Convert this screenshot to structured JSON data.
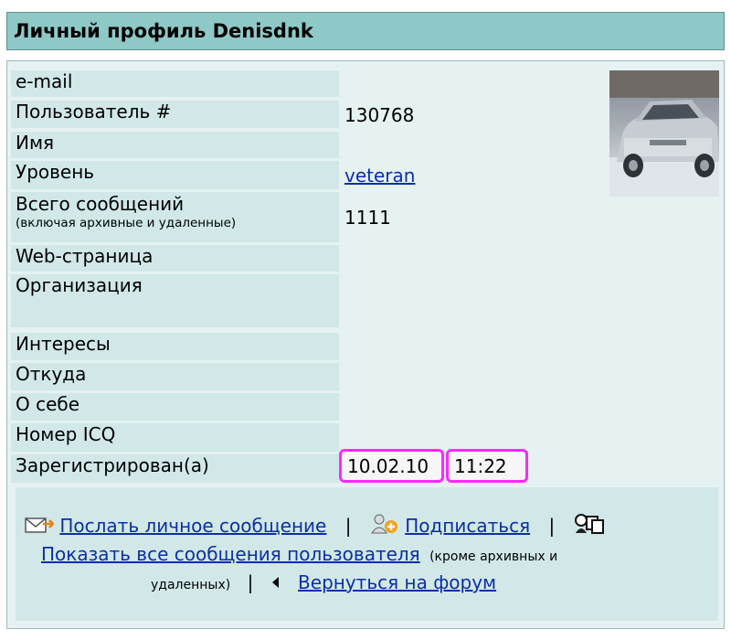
{
  "header": {
    "title": "Личный профиль Denisdnk"
  },
  "profile": {
    "email_label": "e-mail",
    "user_number_label": "Пользователь #",
    "user_number": "130768",
    "name_label": "Имя",
    "level_label": "Уровень",
    "level": "veteran",
    "posts_label": "Всего сообщений",
    "posts_sublabel": "(включая архивные и удаленные)",
    "posts": "1111",
    "webpage_label": "Web-страница",
    "organization_label": "Организация",
    "interests_label": "Интересы",
    "from_label": "Откуда",
    "about_label": "О себе",
    "icq_label": "Номер ICQ",
    "registered_label": "Зарегистрирован(а)",
    "registered_date": "10.02.10",
    "registered_time": "11:22"
  },
  "actions": {
    "send_message": "Послать личное сообщение",
    "separator": "|",
    "subscribe": "Подписаться",
    "show_all_posts": "Показать все сообщения пользователя",
    "show_all_note": "(кроме архивных и",
    "show_all_note2": "удаленных)",
    "back_to_forum": "Вернуться на форум"
  },
  "icons": [
    "envelope-icon",
    "subscribe-user-icon",
    "copy-profile-icon",
    "back-arrow-icon"
  ]
}
